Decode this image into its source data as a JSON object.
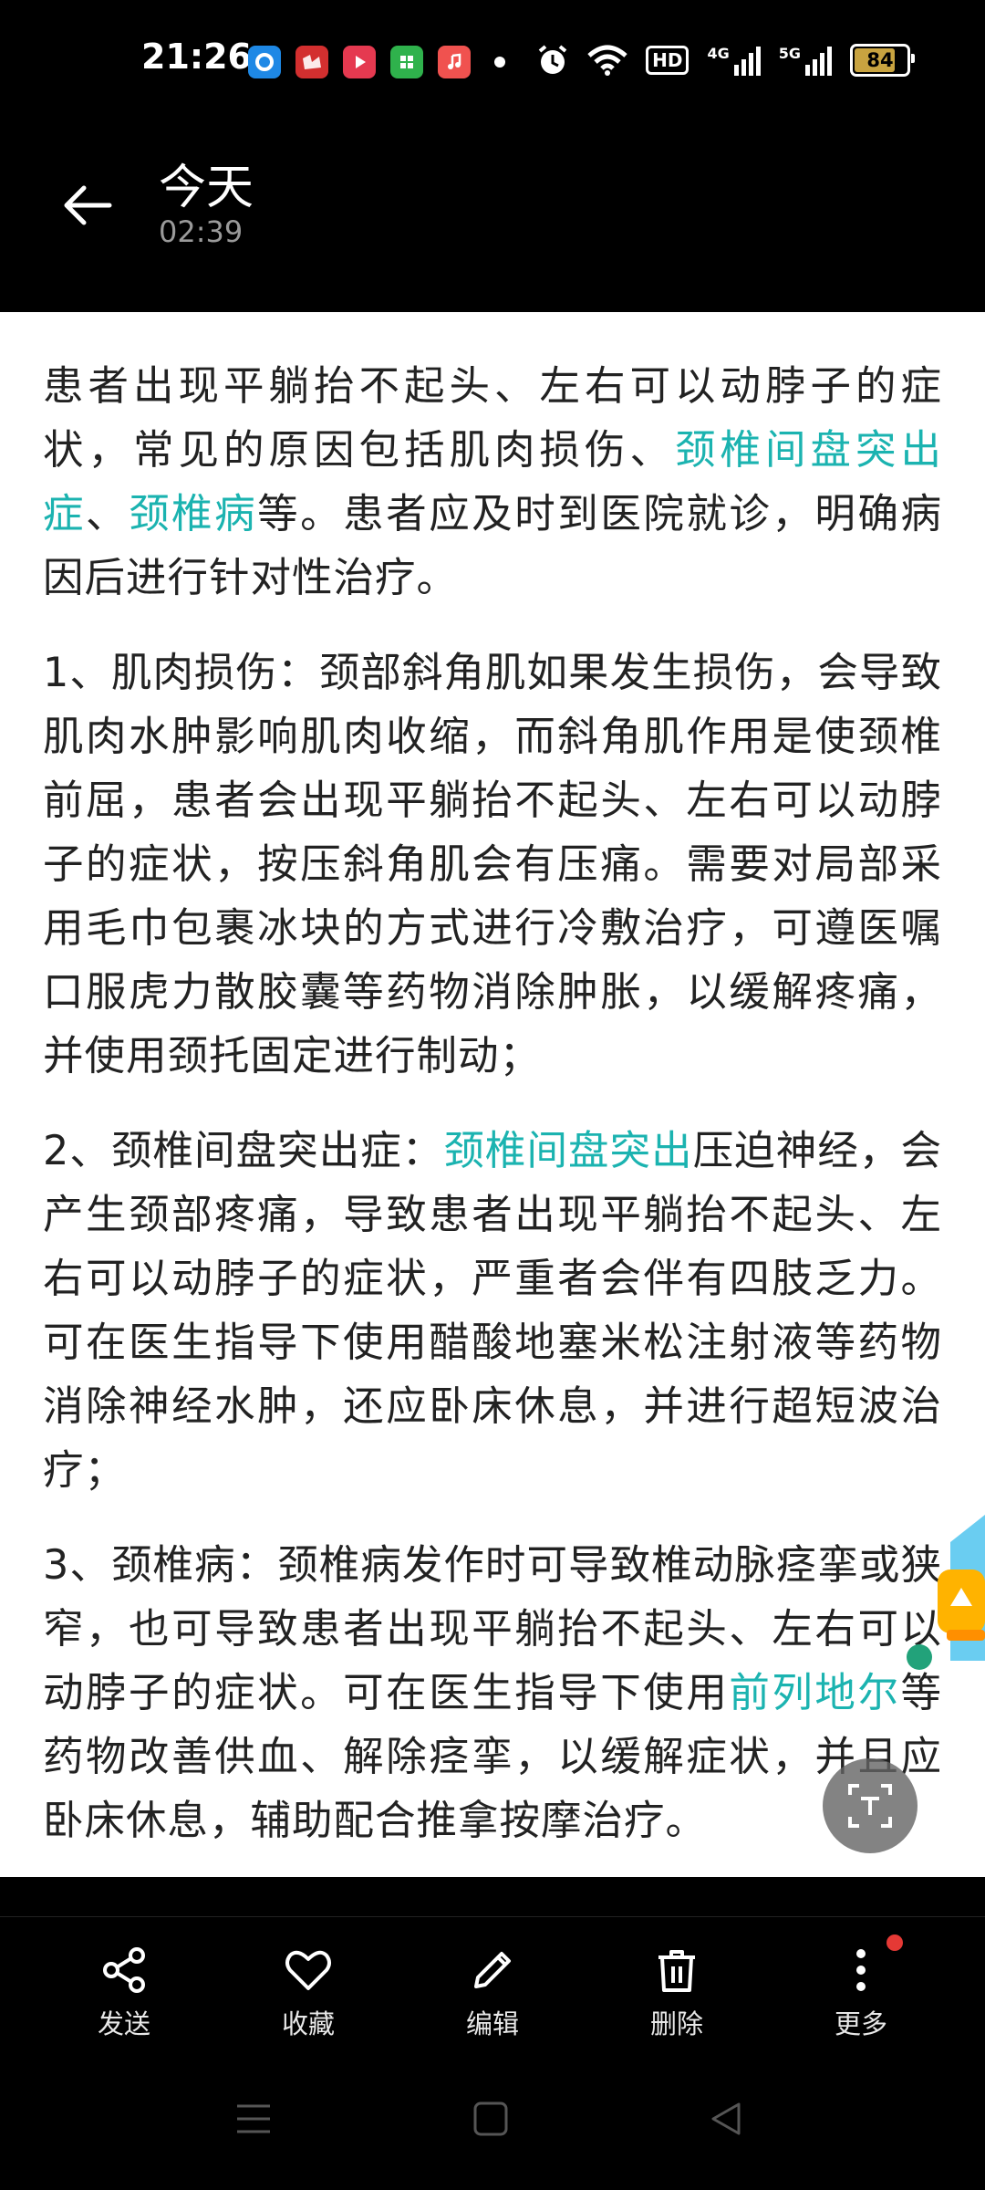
{
  "status_bar": {
    "time": "21:26",
    "battery": "84",
    "battery_level": 0.84,
    "net_hd": "HD",
    "net_4g": "4G",
    "net_5g": "5G"
  },
  "header": {
    "title": "今天",
    "subtitle": "02:39"
  },
  "content": {
    "p1": {
      "t1": "患者出现平躺抬不起头、左右可以动脖子的症状，常见的原因包括肌肉损伤、",
      "link1": "颈椎间盘突出症",
      "t2": "、",
      "link2": "颈椎病",
      "t3": "等。患者应及时到医院就诊，明确病因后进行针对性治疗。"
    },
    "p2": "1、肌肉损伤：颈部斜角肌如果发生损伤，会导致肌肉水肿影响肌肉收缩，而斜角肌作用是使颈椎前屈，患者会出现平躺抬不起头、左右可以动脖子的症状，按压斜角肌会有压痛。需要对局部采用毛巾包裹冰块的方式进行冷敷治疗，可遵医嘱口服虎力散胶囊等药物消除肿胀，以缓解疼痛，并使用颈托固定进行制动；",
    "p3": {
      "t1": "2、颈椎间盘突出症：",
      "link1": "颈椎间盘突出",
      "t2": "压迫神经，会产生颈部疼痛，导致患者出现平躺抬不起头、左右可以动脖子的症状，严重者会伴有四肢乏力。可在医生指导下使用醋酸地塞米松注射液等药物消除神经水肿，还应卧床休息，并进行超短波治疗；"
    },
    "p4": {
      "t1": "3、颈椎病：颈椎病发作时可导致椎动脉痉挛或狭窄，也可导致患者出现平躺抬不起头、左右可以动脖子的症状。可在医生指导下使用",
      "link1": "前列地尔",
      "t2": "等药物改善供血、解除痉挛，以缓解症状，并且应卧床休息，辅助配合推拿按摩治疗。"
    }
  },
  "toolbar": {
    "send": "发送",
    "favorite": "收藏",
    "edit": "编辑",
    "delete": "删除",
    "more": "更多"
  },
  "colors": {
    "link": "#1bb3b0",
    "text": "#222222",
    "battery": "#c8a340"
  }
}
